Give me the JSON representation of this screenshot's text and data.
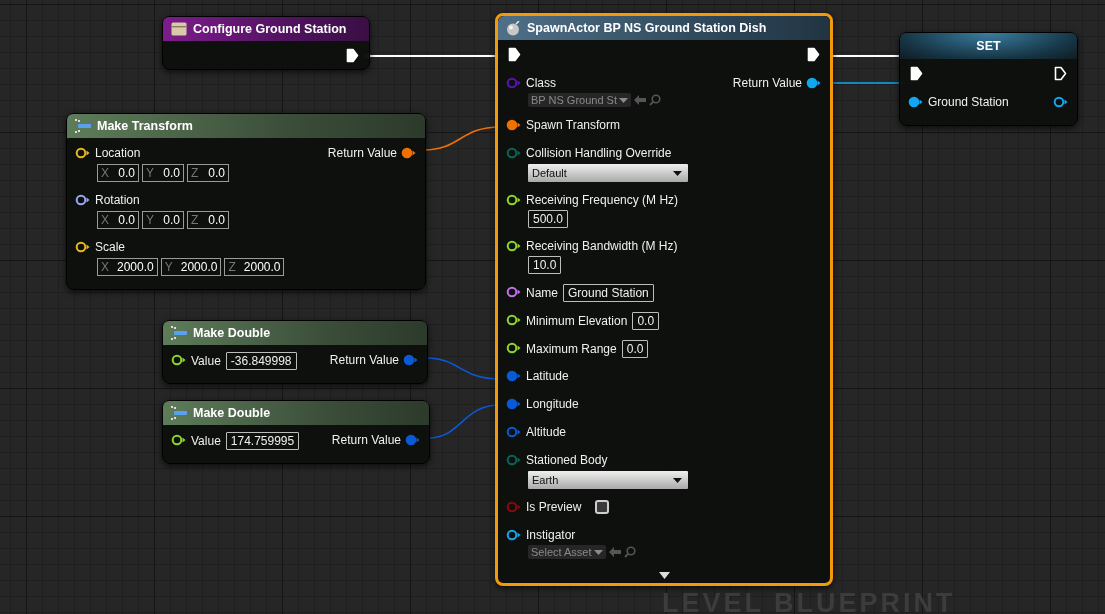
{
  "nodes": [
    {
      "kind": "entry",
      "title": "Configure Ground Station",
      "selected": false,
      "exec_out": {
        "connected": true
      }
    },
    {
      "kind": "pure",
      "title": "Make Transform",
      "selected": false,
      "inputs": [
        {
          "label": "Location",
          "color": "#e8b820",
          "connected": false,
          "kind": "vector",
          "values": [
            {
              "axis": "X",
              "value": "0.0"
            },
            {
              "axis": "Y",
              "value": "0.0"
            },
            {
              "axis": "Z",
              "value": "0.0"
            }
          ]
        },
        {
          "label": "Rotation",
          "color": "#9aa8f0",
          "connected": false,
          "kind": "vector",
          "values": [
            {
              "axis": "X",
              "value": "0.0"
            },
            {
              "axis": "Y",
              "value": "0.0"
            },
            {
              "axis": "Z",
              "value": "0.0"
            }
          ]
        },
        {
          "label": "Scale",
          "color": "#e8b820",
          "connected": false,
          "kind": "vector",
          "values": [
            {
              "axis": "X",
              "value": "2000.0"
            },
            {
              "axis": "Y",
              "value": "2000.0"
            },
            {
              "axis": "Z",
              "value": "2000.0"
            }
          ]
        }
      ],
      "outputs": [
        {
          "label": "Return Value",
          "color": "#f07000",
          "connected": true
        }
      ]
    },
    {
      "kind": "pure",
      "title": "Make Double",
      "selected": false,
      "inputs": [
        {
          "label": "Value",
          "color": "#8ed628",
          "connected": false,
          "kind": "field_inline",
          "value": "-36.849998"
        }
      ],
      "outputs": [
        {
          "label": "Return Value",
          "color": "#0a5ad8",
          "connected": true
        }
      ]
    },
    {
      "kind": "pure",
      "title": "Make Double",
      "selected": false,
      "inputs": [
        {
          "label": "Value",
          "color": "#8ed628",
          "connected": false,
          "kind": "field_inline",
          "value": "174.759995"
        }
      ],
      "outputs": [
        {
          "label": "Return Value",
          "color": "#0a5ad8",
          "connected": true
        }
      ]
    },
    {
      "kind": "call",
      "title": "SpawnActor BP NS Ground Station Dish",
      "selected": true,
      "exec_in": {
        "connected": true
      },
      "exec_out": {
        "connected": true
      },
      "inputs": [
        {
          "label": "Class",
          "color": "#5a14b4",
          "connected": false,
          "kind": "picker",
          "value": "BP NS Ground St"
        },
        {
          "label": "Spawn Transform",
          "color": "#f07000",
          "connected": true,
          "kind": "none"
        },
        {
          "label": "Collision Handling Override",
          "color": "#0a6458",
          "connected": false,
          "kind": "dropdown",
          "value": "Default"
        },
        {
          "label": "Receiving Frequency (M Hz)",
          "color": "#8ed628",
          "connected": false,
          "kind": "field_below",
          "value": "500.0"
        },
        {
          "label": "Receiving Bandwidth (M Hz)",
          "color": "#8ed628",
          "connected": false,
          "kind": "field_below",
          "value": "10.0"
        },
        {
          "label": "Name",
          "color": "#c070e8",
          "connected": false,
          "kind": "field_inline",
          "value": "Ground Station"
        },
        {
          "label": "Minimum Elevation",
          "color": "#8ed628",
          "connected": false,
          "kind": "field_inline",
          "value": "0.0"
        },
        {
          "label": "Maximum Range",
          "color": "#8ed628",
          "connected": false,
          "kind": "field_inline",
          "value": "0.0"
        },
        {
          "label": "Latitude",
          "color": "#0a5ad8",
          "connected": true,
          "kind": "none"
        },
        {
          "label": "Longitude",
          "color": "#0a5ad8",
          "connected": true,
          "kind": "none"
        },
        {
          "label": "Altitude",
          "color": "#0a5ad8",
          "connected": false,
          "kind": "none"
        },
        {
          "label": "Stationed Body",
          "color": "#0a6458",
          "connected": false,
          "kind": "dropdown",
          "value": "Earth"
        },
        {
          "label": "Is Preview",
          "color": "#8a0a0a",
          "connected": false,
          "kind": "checkbox",
          "checked": false
        },
        {
          "label": "Instigator",
          "color": "#10a8f0",
          "connected": false,
          "kind": "picker",
          "value": "Select Asset"
        }
      ],
      "outputs": [
        {
          "label": "Return Value",
          "color": "#10a8f0",
          "connected": true
        }
      ]
    },
    {
      "kind": "set",
      "title": "SET",
      "selected": false,
      "exec_in": {
        "connected": true
      },
      "exec_out": {
        "connected": false
      },
      "inputs": [
        {
          "label": "Ground Station",
          "color": "#10a8f0",
          "connected": true,
          "kind": "none"
        }
      ],
      "outputs": [
        {
          "color": "#10a8f0",
          "connected": false
        }
      ]
    }
  ],
  "watermark": "LEVEL BLUEPRINT"
}
